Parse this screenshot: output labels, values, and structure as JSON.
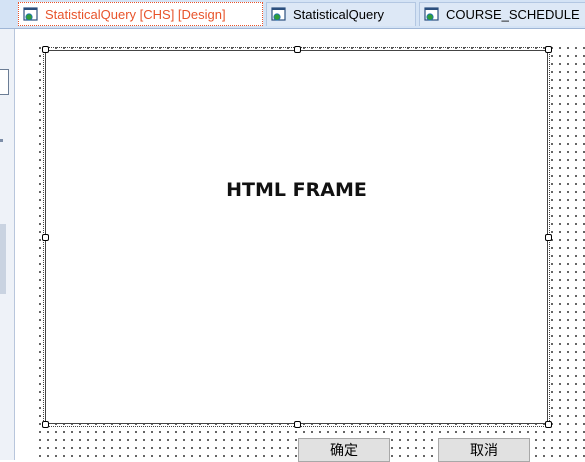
{
  "tabs": [
    {
      "label": "StatisticalQuery [CHS] [Design]",
      "active": true,
      "icon": "document-globe-icon"
    },
    {
      "label": "StatisticalQuery",
      "active": false,
      "icon": "document-globe-icon"
    },
    {
      "label": "COURSE_SCHEDULE",
      "active": false,
      "icon": "document-globe-icon"
    }
  ],
  "designer": {
    "frame_label": "HTML FRAME",
    "buttons": {
      "ok_label": "确定",
      "cancel_label": "取消"
    }
  },
  "colors": {
    "active_tab_text": "#e8542b",
    "tabstrip_bg": "#d4e3f5"
  }
}
